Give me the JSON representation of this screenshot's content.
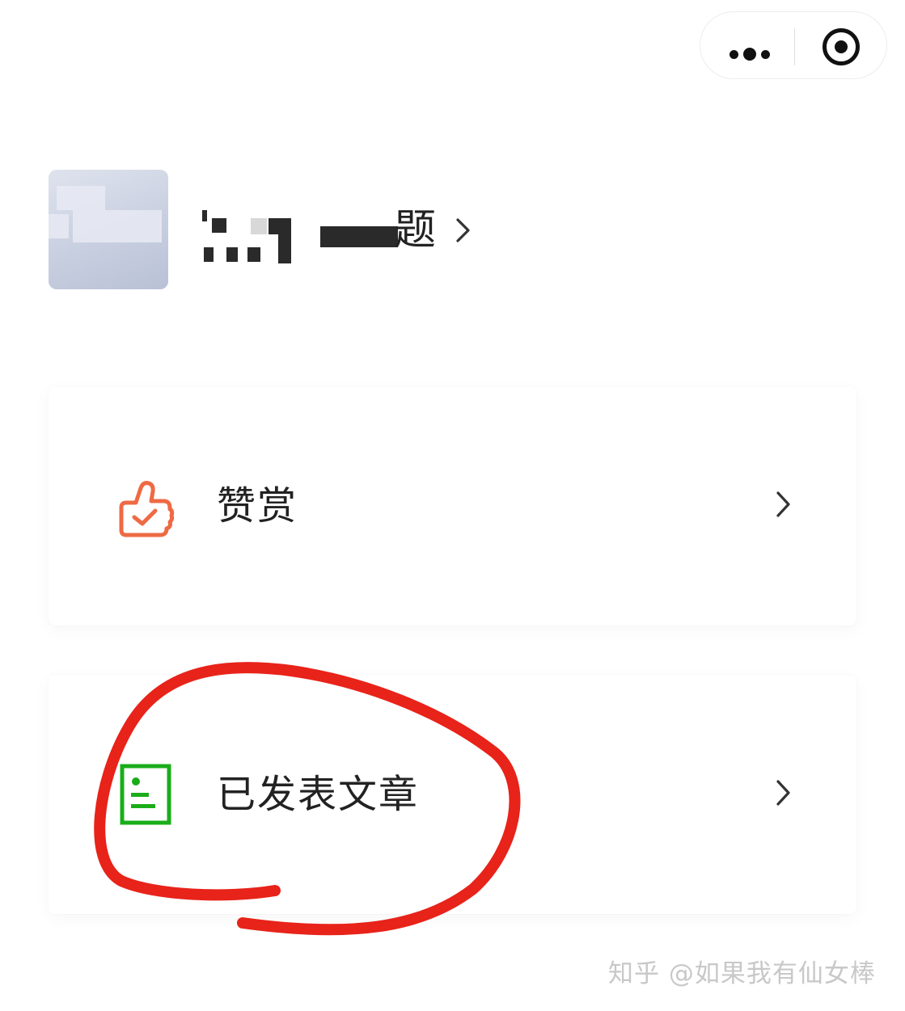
{
  "capsule": {
    "more_icon": "more-dots-icon",
    "close_icon": "target-close-icon"
  },
  "profile": {
    "name_visible": "题",
    "name_masked": true,
    "avatar": "blurred-avatar"
  },
  "menu": [
    {
      "label": "赞赏",
      "icon": "thumbs-up-check-icon",
      "icon_color": "#ee6a44"
    },
    {
      "label": "已发表文章",
      "icon": "article-document-icon",
      "icon_color": "#1aad19"
    }
  ],
  "annotation": {
    "color": "#e8231a",
    "shape": "hand-drawn circle around 已发表文章"
  },
  "watermark": "知乎 @如果我有仙女棒",
  "colors": {
    "text": "#222222",
    "chevron": "#333333",
    "background": "#ffffff"
  }
}
